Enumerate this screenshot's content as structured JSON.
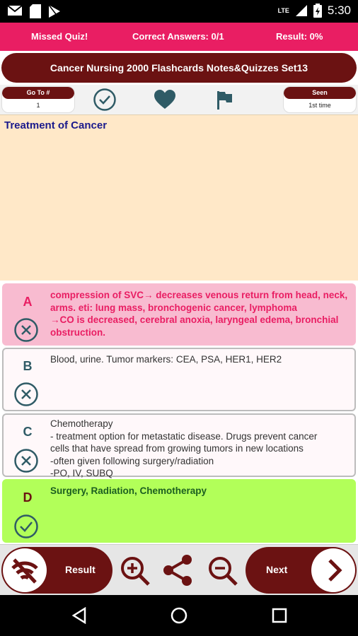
{
  "statusbar": {
    "time": "5:30",
    "network": "LTE"
  },
  "stats": {
    "missed": "Missed Quiz!",
    "correct": "Correct Answers: 0/1",
    "result": "Result: 0%"
  },
  "title": "Cancer Nursing 2000 Flashcards Notes&Quizzes Set13",
  "toolbar": {
    "goto_label": "Go To #",
    "goto_value": "1",
    "seen_label": "Seen",
    "seen_value": "1st time"
  },
  "question": "Treatment of Cancer",
  "options": [
    {
      "letter": "A",
      "state": "wrong-selected",
      "lines": [
        "compression of SVC→ decreases venous return from head, neck,",
        "arms. eti: lung mass, bronchogenic cancer, lymphoma",
        "→CO is decreased, cerebral anoxia, laryngeal edema, bronchial",
        "obstruction."
      ]
    },
    {
      "letter": "B",
      "state": "wrong",
      "lines": [
        "Blood, urine. Tumor markers: CEA, PSA, HER1, HER2"
      ]
    },
    {
      "letter": "C",
      "state": "wrong",
      "lines": [
        "Chemotherapy",
        "- treatment option for metastatic disease. Drugs prevent cancer",
        "cells that have spread from growing tumors in new locations",
        "-often given following surgery/radiation",
        "-PO, IV, SUBQ"
      ]
    },
    {
      "letter": "D",
      "state": "correct",
      "lines": [
        "Surgery, Radiation, Chemotherapy"
      ]
    }
  ],
  "bottom": {
    "result_label": "Result",
    "next_label": "Next"
  },
  "colors": {
    "accent": "#e91e63",
    "dark": "#6b1212",
    "question_bg": "#ffe8c8",
    "wrong_bg": "#f8bbd0",
    "correct_bg": "#b2ff59",
    "neutral_bg": "#fff8fa",
    "icon": "#2f5b66"
  }
}
